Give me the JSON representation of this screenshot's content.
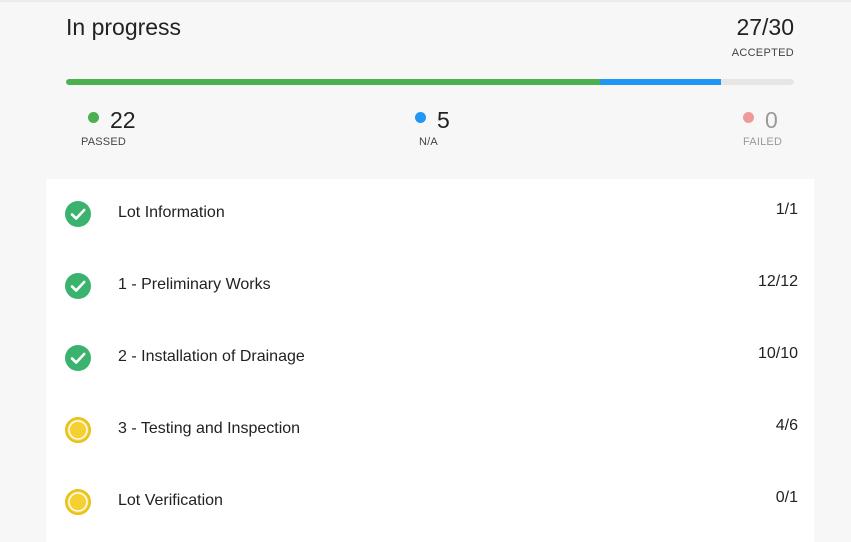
{
  "header": {
    "title": "In progress",
    "accepted_count": "27/30",
    "accepted_label": "ACCEPTED"
  },
  "progress": {
    "total": 30,
    "passed": 22,
    "na": 5,
    "failed": 0,
    "colors": {
      "passed": "#4caf50",
      "na": "#2196f3",
      "failed": "#ef9a9a",
      "track": "#e6e6e6"
    }
  },
  "stats": {
    "passed": {
      "value": "22",
      "label": "PASSED",
      "color": "#4caf50"
    },
    "na": {
      "value": "5",
      "label": "N/A",
      "color": "#2196f3"
    },
    "failed": {
      "value": "0",
      "label": "FAILED",
      "color": "#ef9a9a"
    }
  },
  "items": [
    {
      "label": "Lot Information",
      "count": "1/1",
      "status": "complete",
      "icon": "check-circle-icon"
    },
    {
      "label": "1 - Preliminary Works",
      "count": "12/12",
      "status": "complete",
      "icon": "check-circle-icon"
    },
    {
      "label": "2 - Installation of Drainage",
      "count": "10/10",
      "status": "complete",
      "icon": "check-circle-icon"
    },
    {
      "label": "3 - Testing and Inspection",
      "count": "4/6",
      "status": "in-progress",
      "icon": "pending-circle-icon"
    },
    {
      "label": "Lot Verification",
      "count": "0/1",
      "status": "in-progress",
      "icon": "pending-circle-icon"
    }
  ],
  "status_colors": {
    "complete": "#3bb26d",
    "in_progress_fill": "#f5d033",
    "in_progress_ring": "#e8c11a"
  }
}
